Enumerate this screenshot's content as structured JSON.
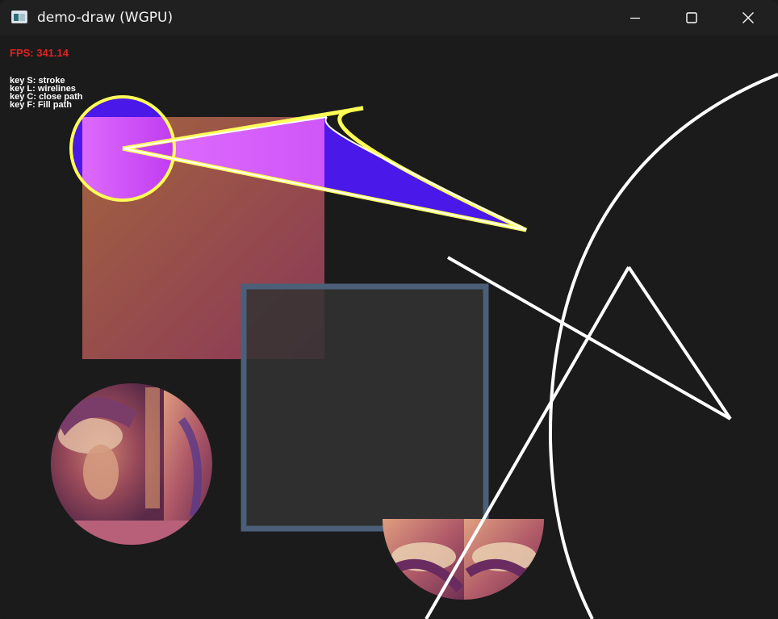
{
  "window": {
    "title": "demo-draw (WGPU)",
    "icons": {
      "app": "window-app-icon",
      "minimize": "minimize-icon",
      "maximize": "maximize-icon",
      "close": "close-icon"
    }
  },
  "overlay": {
    "fps": "FPS: 341.14",
    "keys": [
      "key S: stroke",
      "key L: wirelines",
      "key C: close path",
      "key F: Fill path"
    ]
  },
  "colors": {
    "background": "#1b1b1b",
    "titlebar": "#202020",
    "fps_text": "#e32222",
    "stroke_yellow": "#ffff55",
    "fill_violet": "#4a18e8",
    "fill_magenta": "#d850f8",
    "square_border": "#4b5f78",
    "square_fill": "#2d2d2d",
    "gradient_top": "#a06040",
    "gradient_bottom": "#8a3a5a"
  }
}
